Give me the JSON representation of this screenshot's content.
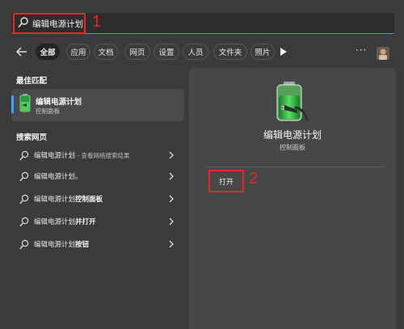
{
  "search": {
    "query": "编辑电源计划",
    "annotation": "1"
  },
  "filters": {
    "active": "全部",
    "items": [
      "应用",
      "文档",
      "网页",
      "设置",
      "人员",
      "文件夹",
      "照片"
    ],
    "more": "···"
  },
  "left": {
    "best_match_title": "最佳匹配",
    "best_match": {
      "title": "编辑电源计划",
      "subtitle": "控制面板"
    },
    "web_title": "搜索网页",
    "web_results": [
      {
        "prefix": "编辑电源计划",
        "suffix": " - 查看网络搜索结果",
        "suffix_bold": false
      },
      {
        "prefix": "编辑电源计划",
        "suffix": "。",
        "suffix_bold": false
      },
      {
        "prefix": "编辑电源计划",
        "suffix": "控制面板",
        "suffix_bold": true
      },
      {
        "prefix": "编辑电源计划",
        "suffix": "并打开",
        "suffix_bold": true
      },
      {
        "prefix": "编辑电源计划",
        "suffix": "按钮",
        "suffix_bold": true
      }
    ]
  },
  "right": {
    "title": "编辑电源计划",
    "subtitle": "控制面板",
    "open_label": "打开",
    "annotation": "2"
  },
  "icons": [
    "search-icon",
    "back-arrow-icon",
    "play-icon",
    "more-icon",
    "battery-plug-icon",
    "chevron-right-icon"
  ],
  "colors": {
    "highlight_red": "#e02a2a",
    "accent_blue": "#4c9cf0",
    "battery_green": "#3fbf3f"
  }
}
